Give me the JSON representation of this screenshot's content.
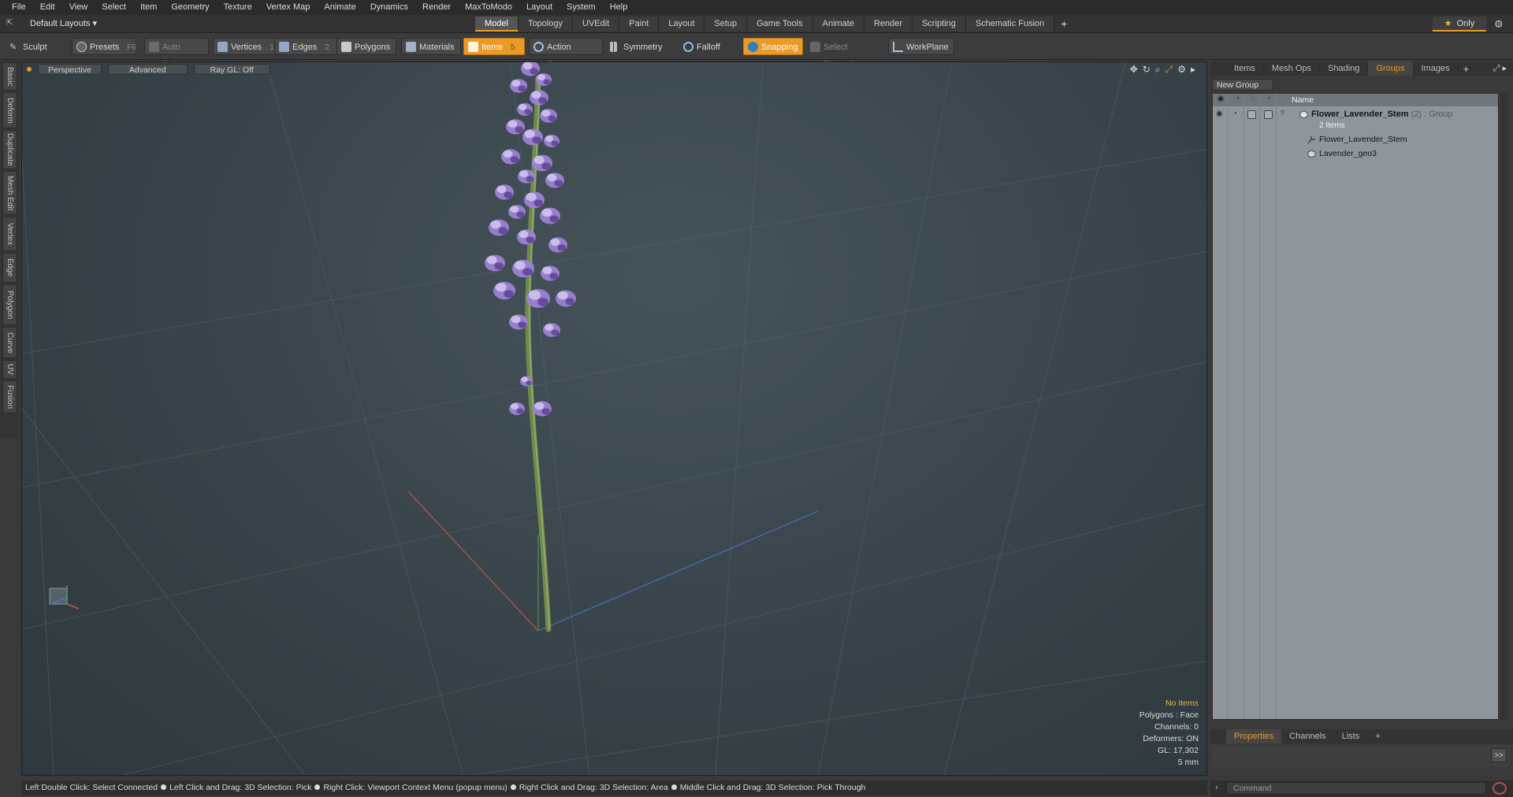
{
  "menu": [
    "File",
    "Edit",
    "View",
    "Select",
    "Item",
    "Geometry",
    "Texture",
    "Vertex Map",
    "Animate",
    "Dynamics",
    "Render",
    "MaxToModo",
    "Layout",
    "System",
    "Help"
  ],
  "layouts": {
    "selector": "Default Layouts ▾",
    "tabs": [
      "Model",
      "Topology",
      "UVEdit",
      "Paint",
      "Layout",
      "Setup",
      "Game Tools",
      "Animate",
      "Render",
      "Scripting",
      "Schematic Fusion"
    ],
    "active_tab": "Model",
    "plus": "+",
    "only_label": "Only",
    "only_star": "★"
  },
  "toolbar": {
    "sculpt": "Sculpt",
    "presets": "Presets",
    "presets_key": "F6",
    "auto_select": "Auto Select",
    "vertices": "Vertices",
    "vertices_key": "1",
    "edges": "Edges",
    "edges_key": "2",
    "polygons": "Polygons",
    "materials": "Materials",
    "items": "Items",
    "items_key": "5",
    "action_center": "Action Center",
    "symmetry": "Symmetry",
    "falloff": "Falloff",
    "snapping": "Snapping",
    "select_through": "Select Through",
    "workplane": "WorkPlane"
  },
  "left_tabs": [
    "Basic",
    "Deform",
    "Duplicate",
    "Mesh Edit",
    "Vertex",
    "Edge",
    "Polygon",
    "Curve",
    "UV",
    "Fusion"
  ],
  "viewport": {
    "view_mode": "Perspective",
    "advanced": "Advanced",
    "ray_gl": "Ray GL: Off",
    "info": {
      "no_items": "No Items",
      "polygons": "Polygons : Face",
      "channels": "Channels: 0",
      "deformers": "Deformers: ON",
      "gl": "GL: 17,302",
      "unit": "5 mm"
    }
  },
  "right_panel": {
    "tabs": [
      "Items",
      "Mesh Ops",
      "Shading",
      "Groups",
      "Images"
    ],
    "active_tab": "Groups",
    "plus": "+",
    "new_group": "New Group",
    "column_name": "Name",
    "group": {
      "name": "Flower_Lavender_Stem",
      "count": "(2)",
      "type": ": Group",
      "sub": "2 Items"
    },
    "children": [
      "Flower_Lavender_Stem",
      "Lavender_geo3"
    ]
  },
  "properties_bar": {
    "tabs": [
      "Properties",
      "Channels",
      "Lists"
    ],
    "active_tab": "Properties",
    "plus": "+",
    "expand": ">>"
  },
  "status_bar": [
    "Left Double Click: Select Connected",
    "Left Click and Drag: 3D Selection: Pick",
    "Right Click: Viewport Context Menu (popup menu)",
    "Right Click and Drag: 3D Selection: Area",
    "Middle Click and Drag: 3D Selection: Pick Through"
  ],
  "command": {
    "placeholder": "Command"
  },
  "colors": {
    "accent": "#e99a27",
    "viewport_bg": "#37434a",
    "tree_bg": "#8e969c",
    "flower": "#9d82d4",
    "stem": "#6f8a4d"
  }
}
